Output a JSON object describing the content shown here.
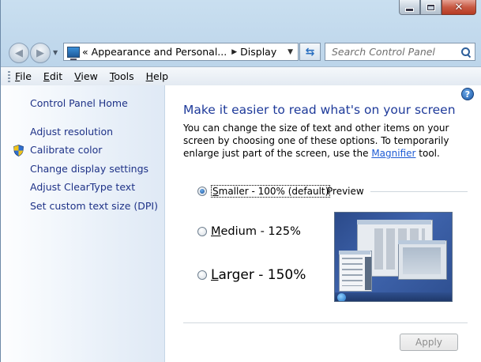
{
  "window": {
    "controls": {
      "minimize_icon": "minimize-icon",
      "maximize_icon": "maximize-icon",
      "close_icon": "close-icon"
    }
  },
  "nav": {
    "back_icon": "back-arrow-icon",
    "forward_icon": "forward-arrow-icon",
    "recent_icon": "chevron-down-icon",
    "breadcrumb_prefix": "«",
    "breadcrumb": [
      "Appearance and Personal...",
      "Display"
    ],
    "refresh_icon": "refresh-icon",
    "search_placeholder": "Search Control Panel"
  },
  "menu": {
    "items": [
      {
        "label": "File",
        "accel": "F"
      },
      {
        "label": "Edit",
        "accel": "E"
      },
      {
        "label": "View",
        "accel": "V"
      },
      {
        "label": "Tools",
        "accel": "T"
      },
      {
        "label": "Help",
        "accel": "H"
      }
    ]
  },
  "sidebar": {
    "home": "Control Panel Home",
    "links": [
      "Adjust resolution",
      "Calibrate color",
      "Change display settings",
      "Adjust ClearType text",
      "Set custom text size (DPI)"
    ],
    "shield_icon": "uac-shield-icon"
  },
  "main": {
    "help_icon": "help-icon",
    "title": "Make it easier to read what's on your screen",
    "desc_before": "You can change the size of text and other items on your screen by choosing one of these options. To temporarily enlarge just part of the screen, use the ",
    "desc_link": "Magnifier",
    "desc_after": " tool.",
    "options": [
      {
        "accel": "S",
        "rest": "maller - 100% (default)",
        "selected": true
      },
      {
        "accel": "M",
        "rest": "edium - 125%",
        "selected": false
      },
      {
        "accel": "L",
        "rest": "arger - 150%",
        "selected": false
      }
    ],
    "preview_label": "Preview",
    "apply_label": "Apply",
    "apply_enabled": false
  },
  "colors": {
    "title_text": "#1e3a9a",
    "link_text": "#1e3287",
    "hyperlink": "#1e5bd4",
    "disabled_text": "#8d8d8d",
    "close_button": "#c85a44"
  }
}
